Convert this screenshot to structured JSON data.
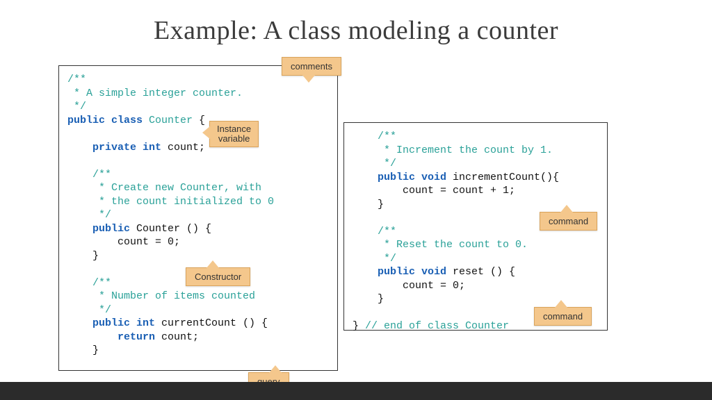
{
  "title": "Example: A class modeling a counter",
  "left": {
    "l1": "/**",
    "l2": " * A simple integer counter.",
    "l3": " */",
    "l4a": "public class",
    "l4b": " Counter",
    "l4c": " {",
    "l5": "",
    "l6a": "    private int",
    "l6b": " count;",
    "l7": "",
    "l8": "    /**",
    "l9": "     * Create new Counter, with",
    "l10": "     * the count initialized to 0",
    "l11": "     */",
    "l12a": "    public",
    "l12b": " Counter () {",
    "l13": "        count = 0;",
    "l14": "    }",
    "l15": "",
    "l16": "    /**",
    "l17": "     * Number of items counted",
    "l18": "     */",
    "l19a": "    public int",
    "l19b": " currentCount () {",
    "l20a": "        return",
    "l20b": " count;",
    "l21": "    }"
  },
  "right": {
    "l1": "    /**",
    "l2": "     * Increment the count by 1.",
    "l3": "     */",
    "l4a": "    public void",
    "l4b": " incrementCount(){",
    "l5": "        count = count + 1;",
    "l6": "    }",
    "l7": "",
    "l8": "    /**",
    "l9": "     * Reset the count to 0.",
    "l10": "     */",
    "l11a": "    public void",
    "l11b": " reset () {",
    "l12": "        count = 0;",
    "l13": "    }",
    "l14": "",
    "l15a": "} ",
    "l15b": "// end of class Counter"
  },
  "callouts": {
    "comments": "comments",
    "instance_variable": "Instance\nvariable",
    "constructor": "Constructor",
    "query": "query",
    "command1": "command",
    "command2": "command"
  }
}
